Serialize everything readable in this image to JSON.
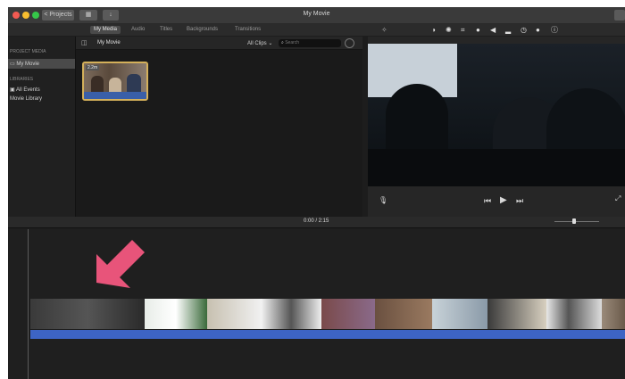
{
  "titlebar": {
    "projects_label": "< Projects",
    "title": "My Movie"
  },
  "tabs": [
    {
      "label": "My Media",
      "active": true
    },
    {
      "label": "Audio",
      "active": false
    },
    {
      "label": "Titles",
      "active": false
    },
    {
      "label": "Backgrounds",
      "active": false
    },
    {
      "label": "Transitions",
      "active": false
    }
  ],
  "sidebar": {
    "project_media_label": "PROJECT MEDIA",
    "project_item": "My Movie",
    "libraries_label": "LIBRARIES",
    "all_events": "All Events",
    "movie_library": "Movie Library"
  },
  "browser": {
    "heading": "My Movie",
    "filter": "All Clips",
    "search_placeholder": "Search",
    "thumb_duration": "2.2m"
  },
  "viewer_tools": [
    "magic-wand-icon",
    "color-balance-icon",
    "color-correction-icon",
    "crop-icon",
    "stabilize-icon",
    "volume-icon",
    "noise-reduction-icon",
    "speed-icon",
    "filter-icon",
    "info-icon"
  ],
  "timeline": {
    "timecode": "0:00 / 2:15"
  },
  "colors": {
    "app_bg": "#1d1d1d",
    "audio_track": "#3d64c4",
    "selection_outline": "#d4b05a",
    "arrow": "#e8547a"
  }
}
